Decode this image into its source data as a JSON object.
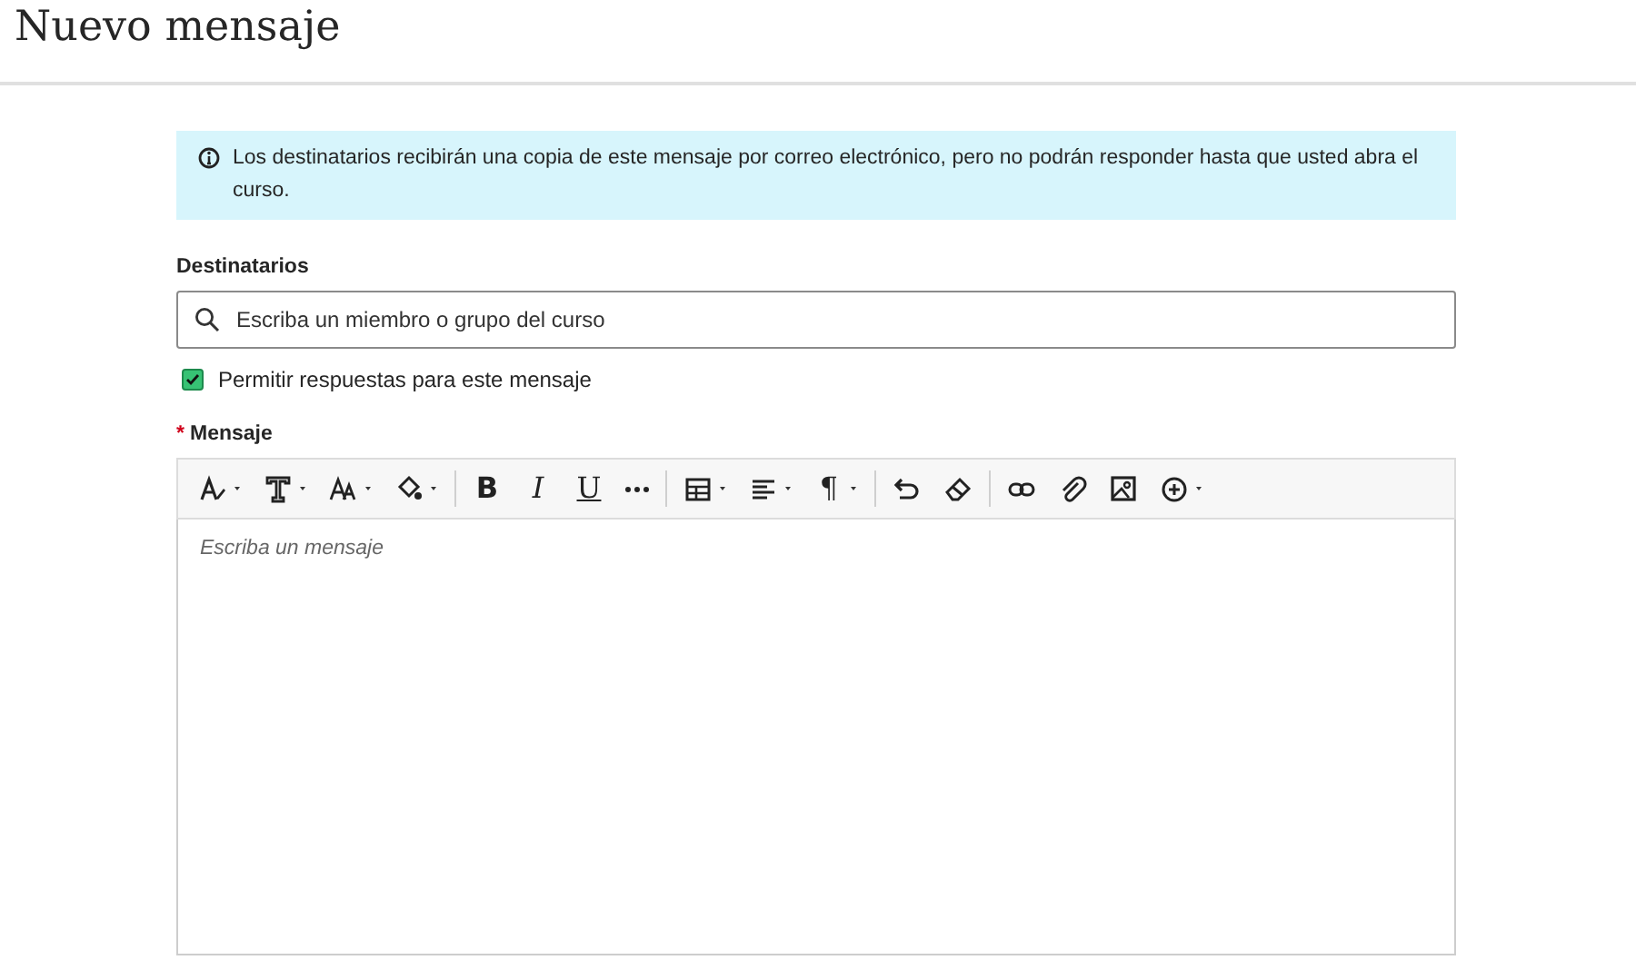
{
  "page_title": "Nuevo mensaje",
  "notice": {
    "text": "Los destinatarios recibirán una copia de este mensaje por correo electrónico, pero no podrán responder hasta que usted abra el curso."
  },
  "recipients": {
    "label": "Destinatarios",
    "placeholder": "Escriba un miembro o grupo del curso"
  },
  "allow_replies": {
    "label": "Permitir respuestas para este mensaje",
    "checked": true
  },
  "message": {
    "label": "Mensaje",
    "required_mark": "*",
    "placeholder": "Escriba un mensaje",
    "toolbar": [
      {
        "kind": "text-style",
        "dropdown": true
      },
      {
        "kind": "font",
        "dropdown": true
      },
      {
        "kind": "size",
        "dropdown": true
      },
      {
        "kind": "fill",
        "dropdown": true
      },
      {
        "kind": "separator"
      },
      {
        "kind": "bold",
        "label": "B"
      },
      {
        "kind": "italic",
        "label": "I"
      },
      {
        "kind": "underline",
        "label": "U"
      },
      {
        "kind": "more"
      },
      {
        "kind": "separator"
      },
      {
        "kind": "table",
        "dropdown": true
      },
      {
        "kind": "align",
        "dropdown": true
      },
      {
        "kind": "paragraph",
        "label": "¶",
        "dropdown": true
      },
      {
        "kind": "separator"
      },
      {
        "kind": "undo"
      },
      {
        "kind": "eraser"
      },
      {
        "kind": "separator"
      },
      {
        "kind": "link"
      },
      {
        "kind": "attach"
      },
      {
        "kind": "image"
      },
      {
        "kind": "insert",
        "dropdown": true
      }
    ]
  }
}
